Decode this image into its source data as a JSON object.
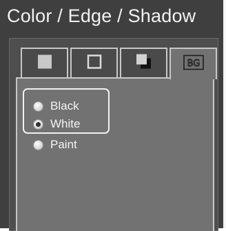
{
  "panel": {
    "title": "Color / Edge / Shadow"
  },
  "tabs": [
    {
      "id": "color",
      "icon": "filled-square-icon",
      "active": false
    },
    {
      "id": "edge",
      "icon": "outlined-square-icon",
      "active": false
    },
    {
      "id": "shadow",
      "icon": "shadow-square-icon",
      "active": false
    },
    {
      "id": "bg",
      "icon": "bg-icon",
      "label": "BG",
      "active": true
    }
  ],
  "background_options": {
    "selected": "White",
    "options": [
      {
        "label": "Black",
        "checked": false
      },
      {
        "label": "White",
        "checked": true
      },
      {
        "label": "Paint",
        "checked": false
      }
    ]
  },
  "colors": {
    "panel_bg": "#3f3f3f",
    "tab_active_bg": "#727272",
    "tab_inactive_bg": "#4a4a4a",
    "tab_border": "#c8c8c8",
    "text": "#f2f2f2"
  }
}
